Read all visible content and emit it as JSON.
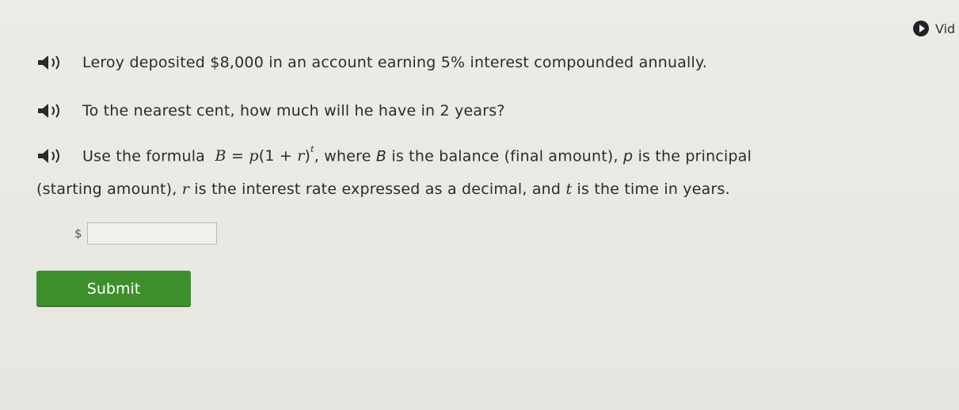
{
  "header": {
    "video_label": "Vid"
  },
  "question": {
    "line1": "Leroy deposited $8,000 in an account earning 5% interest compounded annually.",
    "line2": "To the nearest cent, how much will he have in 2 years?",
    "line3_prefix": "Use the formula",
    "formula_B": "B",
    "formula_eq": "=",
    "formula_p": "p",
    "formula_open": "(1 +",
    "formula_r": "r",
    "formula_close": ")",
    "formula_t": "t",
    "line3_after_formula": ", where",
    "var_B": "B",
    "line3_mid": "is the balance (final amount),",
    "var_p": "p",
    "line3_end": "is the principal",
    "cont_prefix": "(starting amount),",
    "var_r": "r",
    "cont_mid": "is the interest rate expressed as a decimal, and",
    "var_t": "t",
    "cont_end": "is the time in years."
  },
  "answer": {
    "currency_symbol": "$",
    "value": ""
  },
  "actions": {
    "submit_label": "Submit"
  },
  "colors": {
    "submit_bg": "#3e8f2b",
    "background": "#e9e8e3"
  },
  "icons": {
    "speaker": "speaker-icon",
    "video": "play-icon"
  }
}
